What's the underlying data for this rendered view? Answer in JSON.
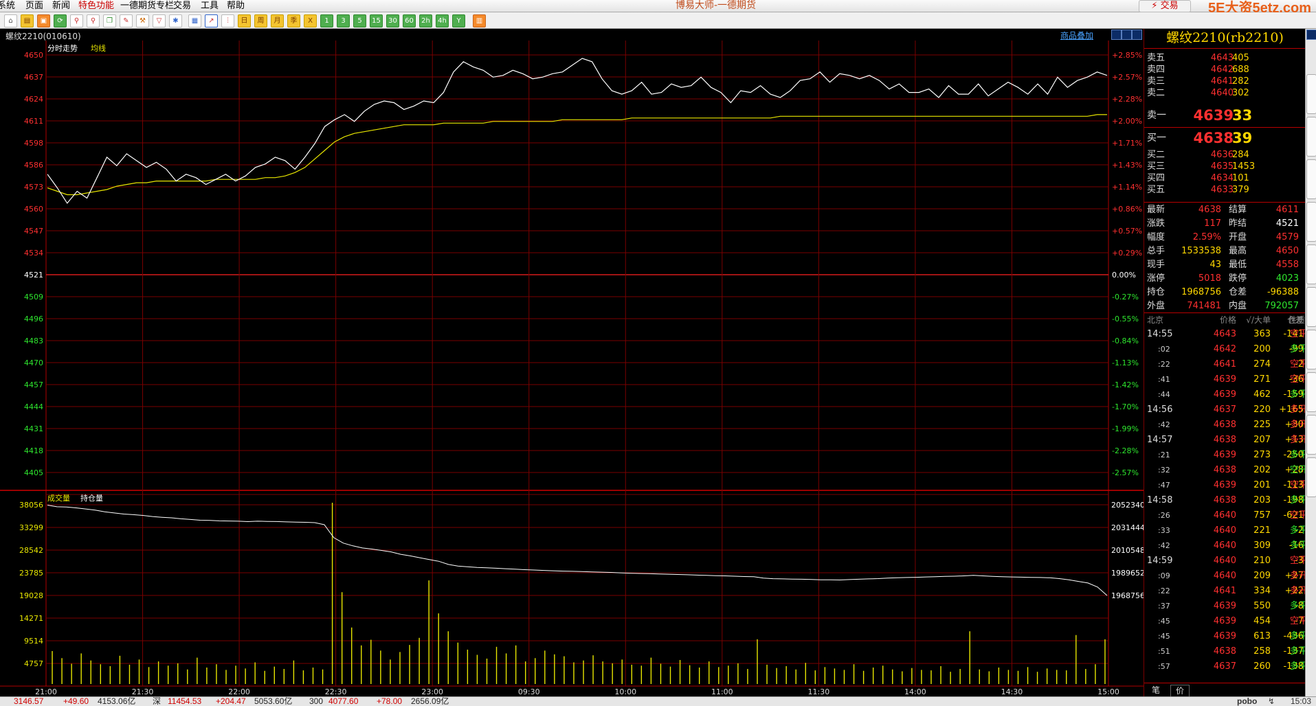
{
  "app_title": "博易大师-一德期货",
  "watermark": "5E大资5etz.com",
  "trade_button": "交易",
  "menus": [
    "系统",
    "页面",
    "新闻",
    "特色功能",
    "一德期货专栏",
    "交易",
    "工具",
    "帮助"
  ],
  "toolbar": {
    "icons": [
      "home-icon",
      "folder-icon",
      "news-icon",
      "refresh-icon",
      "zoom-in-icon",
      "zoom-out-icon",
      "window-icon",
      "pen-icon",
      "tool-icon",
      "filter-icon",
      "settings-icon",
      "table-icon",
      "intraday-icon",
      "kline-icon"
    ],
    "periods": [
      "日",
      "周",
      "月",
      "季",
      "X",
      "1",
      "3",
      "5",
      "15",
      "30",
      "60",
      "2h",
      "4h",
      "Y"
    ]
  },
  "symbol_label": "螺纹2210(010610)",
  "overlay_link": "商品叠加",
  "chart_data": [
    {
      "type": "line",
      "title": "分时走势",
      "series": [
        {
          "name": "分时走势",
          "color": "#ffffff",
          "values": [
            4580,
            4572,
            4563,
            4570,
            4566,
            4578,
            4590,
            4585,
            4592,
            4588,
            4584,
            4587,
            4583,
            4576,
            4580,
            4578,
            4574,
            4577,
            4580,
            4576,
            4579,
            4584,
            4586,
            4590,
            4588,
            4583,
            4590,
            4598,
            4608,
            4612,
            4615,
            4611,
            4617,
            4621,
            4623,
            4622,
            4618,
            4620,
            4623,
            4622,
            4628,
            4640,
            4646,
            4643,
            4641,
            4637,
            4638,
            4641,
            4639,
            4636,
            4637,
            4639,
            4640,
            4644,
            4648,
            4646,
            4636,
            4629,
            4627,
            4629,
            4634,
            4627,
            4628,
            4633,
            4631,
            4632,
            4637,
            4631,
            4628,
            4622,
            4629,
            4628,
            4632,
            4627,
            4625,
            4629,
            4635,
            4636,
            4640,
            4634,
            4639,
            4638,
            4636,
            4638,
            4635,
            4630,
            4633,
            4628,
            4628,
            4630,
            4625,
            4632,
            4627,
            4627,
            4633,
            4626,
            4630,
            4634,
            4631,
            4627,
            4633,
            4627,
            4637,
            4631,
            4635,
            4637,
            4640,
            4638
          ]
        },
        {
          "name": "均线",
          "color": "#e8e600",
          "values": [
            4572,
            4570,
            4568,
            4568,
            4569,
            4570,
            4571,
            4573,
            4574,
            4575,
            4575,
            4576,
            4576,
            4576,
            4576,
            4576,
            4576,
            4577,
            4577,
            4577,
            4577,
            4577,
            4578,
            4578,
            4579,
            4581,
            4584,
            4589,
            4594,
            4599,
            4602,
            4604,
            4605,
            4606,
            4607,
            4608,
            4609,
            4609,
            4609,
            4609,
            4610,
            4610,
            4610,
            4610,
            4610,
            4611,
            4611,
            4611,
            4611,
            4611,
            4611,
            4611,
            4612,
            4612,
            4612,
            4612,
            4612,
            4612,
            4612,
            4613,
            4613,
            4613,
            4613,
            4613,
            4613,
            4613,
            4613,
            4613,
            4613,
            4613,
            4613,
            4613,
            4613,
            4613,
            4614,
            4614,
            4614,
            4614,
            4614,
            4614,
            4614,
            4614,
            4614,
            4614,
            4614,
            4614,
            4614,
            4614,
            4614,
            4614,
            4614,
            4614,
            4614,
            4614,
            4614,
            4614,
            4614,
            4614,
            4614,
            4614,
            4614,
            4614,
            4614,
            4614,
            4614,
            4614,
            4615,
            4615
          ]
        }
      ],
      "price_ticks": [
        "4650",
        "4637",
        "4624",
        "4611",
        "4598",
        "4586",
        "4573",
        "4560",
        "4547",
        "4534",
        "4521",
        "4509",
        "4496",
        "4483",
        "4470",
        "4457",
        "4444",
        "4431",
        "4418",
        "4405"
      ],
      "pct_ticks": [
        "+2.85%",
        "+2.57%",
        "+2.28%",
        "+2.00%",
        "+1.71%",
        "+1.43%",
        "+1.14%",
        "+0.86%",
        "+0.57%",
        "+0.29%",
        "0.00%",
        "-0.27%",
        "-0.55%",
        "-0.84%",
        "-1.13%",
        "-1.42%",
        "-1.70%",
        "-1.99%",
        "-2.28%",
        "-2.57%"
      ],
      "reference_price": 4521,
      "ylim": [
        4405,
        4650
      ]
    },
    {
      "type": "bar",
      "title": "成交量",
      "secondary_label": "持仓量",
      "volume_ticks": [
        "38056",
        "33299",
        "28542",
        "23785",
        "19028",
        "14271",
        "9514",
        "4757"
      ],
      "oi_ticks": [
        "2052340",
        "2031444",
        "2010548",
        "1989652",
        "1968756"
      ],
      "volume": [
        7000,
        5500,
        4300,
        6500,
        5000,
        4200,
        3800,
        6000,
        4100,
        5200,
        3600,
        4800,
        3900,
        4400,
        3100,
        5600,
        3500,
        4200,
        3000,
        3900,
        3300,
        4600,
        2800,
        3700,
        3200,
        5000,
        2900,
        3500,
        3100,
        38500,
        19500,
        12000,
        8200,
        9400,
        7100,
        5200,
        6800,
        8300,
        9800,
        22000,
        15000,
        11200,
        8800,
        7300,
        6200,
        5400,
        7900,
        6500,
        8200,
        4800,
        5500,
        7100,
        6300,
        5900,
        4600,
        5000,
        6100,
        4800,
        4400,
        5200,
        4100,
        3900,
        5600,
        4300,
        3700,
        5100,
        4000,
        3500,
        4800,
        3600,
        3900,
        4400,
        3200,
        9500,
        4100,
        3400,
        3800,
        3100,
        4500,
        2900,
        3600,
        3300,
        3000,
        4200,
        2800,
        3500,
        3900,
        3100,
        2700,
        3400,
        3000,
        2900,
        3800,
        2600,
        3200,
        11200,
        3100,
        2700,
        3500,
        3000,
        2800,
        3600,
        2600,
        3300,
        3000,
        2900,
        10400,
        3200,
        4200,
        9500
      ],
      "open_interest": [
        2052000,
        2050500,
        2050300,
        2049500,
        2048500,
        2047400,
        2045800,
        2044800,
        2043800,
        2043200,
        2042500,
        2041500,
        2040800,
        2040300,
        2039400,
        2038800,
        2038100,
        2037900,
        2037500,
        2037400,
        2037200,
        2036800,
        2037200,
        2037000,
        2036900,
        2036600,
        2036400,
        2036200,
        2035900,
        2034000,
        2022000,
        2017000,
        2014500,
        2012500,
        2011500,
        2010200,
        2008900,
        2006700,
        2005200,
        2003500,
        2001800,
        2000200,
        1997300,
        1995800,
        1995200,
        1994600,
        1994200,
        1993800,
        1993400,
        1993000,
        1992500,
        1992200,
        1991800,
        1991500,
        1991200,
        1991000,
        1990700,
        1990400,
        1990200,
        1990000,
        1989600,
        1989300,
        1989000,
        1988800,
        1988500,
        1988300,
        1988100,
        1987800,
        1987500,
        1987300,
        1987000,
        1986800,
        1986500,
        1986200,
        1986000,
        1984800,
        1984200,
        1984000,
        1983800,
        1983700,
        1983500,
        1983200,
        1983200,
        1983000,
        1983400,
        1983700,
        1984000,
        1984300,
        1984800,
        1985000,
        1985300,
        1985500,
        1985800,
        1986000,
        1986300,
        1986500,
        1986800,
        1987300,
        1986800,
        1986300,
        1986000,
        1985800,
        1985600,
        1985400,
        1985300,
        1985000,
        1984300,
        1983200,
        1981700,
        1980200,
        1976500,
        1968700
      ],
      "ylim": [
        0,
        38056
      ],
      "oi_range": [
        1968756,
        2052340
      ]
    }
  ],
  "x_ticks": [
    "21:00",
    "21:30",
    "22:00",
    "22:30",
    "23:00",
    "09:30",
    "10:00",
    "11:00",
    "11:30",
    "14:00",
    "14:30",
    "15:00"
  ],
  "quote": {
    "title": "螺纹2210(rb2210)",
    "asks": [
      {
        "label": "卖五",
        "price": "4643",
        "vol": "405"
      },
      {
        "label": "卖四",
        "price": "4642",
        "vol": "688"
      },
      {
        "label": "卖三",
        "price": "4641",
        "vol": "282"
      },
      {
        "label": "卖二",
        "price": "4640",
        "vol": "302"
      },
      {
        "label": "卖一",
        "price": "4639",
        "vol": "33"
      }
    ],
    "bids": [
      {
        "label": "买一",
        "price": "4638",
        "vol": "39"
      },
      {
        "label": "买二",
        "price": "4636",
        "vol": "284"
      },
      {
        "label": "买三",
        "price": "4635",
        "vol": "1453"
      },
      {
        "label": "买四",
        "price": "4634",
        "vol": "101"
      },
      {
        "label": "买五",
        "price": "4633",
        "vol": "379"
      }
    ],
    "stats": [
      {
        "l1": "最新",
        "v1": "4638",
        "c1": "#ff3030",
        "l2": "结算",
        "v2": "4611",
        "c2": "#ff3030"
      },
      {
        "l1": "涨跌",
        "v1": "117",
        "c1": "#ff3030",
        "l2": "昨结",
        "v2": "4521",
        "c2": "#ffffff"
      },
      {
        "l1": "幅度",
        "v1": "2.59%",
        "c1": "#ff3030",
        "l2": "开盘",
        "v2": "4579",
        "c2": "#ff3030"
      },
      {
        "l1": "总手",
        "v1": "1533538",
        "c1": "#ffd700",
        "l2": "最高",
        "v2": "4650",
        "c2": "#ff3030"
      },
      {
        "l1": "现手",
        "v1": "43",
        "c1": "#ffd700",
        "l2": "最低",
        "v2": "4558",
        "c2": "#ff3030"
      },
      {
        "l1": "涨停",
        "v1": "5018",
        "c1": "#ff3030",
        "l2": "跌停",
        "v2": "4023",
        "c2": "#2ee62e"
      },
      {
        "l1": "持仓",
        "v1": "1968756",
        "c1": "#ffd700",
        "l2": "仓差",
        "v2": "-96388",
        "c2": "#ffd700"
      },
      {
        "l1": "外盘",
        "v1": "741481",
        "c1": "#ff3030",
        "l2": "内盘",
        "v2": "792057",
        "c2": "#2ee62e"
      }
    ],
    "trades_header": {
      "time": "北京",
      "price": "价格",
      "vol": "√/大单",
      "oi": "仓差",
      "nature": "性质"
    },
    "trades": [
      {
        "time": "14:55",
        "price": "4643",
        "vol": "363",
        "oi": "-141",
        "oi_color": "#ffd700",
        "nature": "空平",
        "nat_color": "#ff3030"
      },
      {
        "time": ":02",
        "price": "4642",
        "vol": "200",
        "oi": "-99",
        "oi_color": "#ffd700",
        "nature": "多平",
        "nat_color": "#2ee62e"
      },
      {
        "time": ":22",
        "price": "4641",
        "vol": "274",
        "oi": "-2",
        "oi_color": "#ffd700",
        "nature": "空平",
        "nat_color": "#ff3030"
      },
      {
        "time": ":41",
        "price": "4639",
        "vol": "271",
        "oi": "-36",
        "oi_color": "#ffd700",
        "nature": "空平",
        "nat_color": "#ff3030"
      },
      {
        "time": ":44",
        "price": "4639",
        "vol": "462",
        "oi": "-159",
        "oi_color": "#ffd700",
        "nature": "多平",
        "nat_color": "#2ee62e"
      },
      {
        "time": "14:56",
        "price": "4637",
        "vol": "220",
        "oi": "+165",
        "oi_color": "#ffd700",
        "nature": "多开",
        "nat_color": "#ff3030"
      },
      {
        "time": ":42",
        "price": "4638",
        "vol": "225",
        "oi": "+30",
        "oi_color": "#ffd700",
        "nature": "多开",
        "nat_color": "#ff3030"
      },
      {
        "time": "14:57",
        "price": "4638",
        "vol": "207",
        "oi": "+13",
        "oi_color": "#ffd700",
        "nature": "多开",
        "nat_color": "#ff3030"
      },
      {
        "time": ":21",
        "price": "4639",
        "vol": "273",
        "oi": "-250",
        "oi_color": "#ffd700",
        "nature": "多平",
        "nat_color": "#2ee62e"
      },
      {
        "time": ":32",
        "price": "4638",
        "vol": "202",
        "oi": "+28",
        "oi_color": "#ffd700",
        "nature": "空开",
        "nat_color": "#2ee62e"
      },
      {
        "time": ":47",
        "price": "4639",
        "vol": "201",
        "oi": "-113",
        "oi_color": "#ffd700",
        "nature": "空平",
        "nat_color": "#ff3030"
      },
      {
        "time": "14:58",
        "price": "4638",
        "vol": "203",
        "oi": "-198",
        "oi_color": "#ffd700",
        "nature": "多平",
        "nat_color": "#2ee62e"
      },
      {
        "time": ":26",
        "price": "4640",
        "vol": "757",
        "oi": "-621",
        "oi_color": "#ffd700",
        "nature": "空平",
        "nat_color": "#ff3030"
      },
      {
        "time": ":33",
        "price": "4640",
        "vol": "221",
        "oi": "-2",
        "oi_color": "#ffd700",
        "nature": "多平",
        "nat_color": "#2ee62e"
      },
      {
        "time": ":42",
        "price": "4640",
        "vol": "309",
        "oi": "-16",
        "oi_color": "#ffd700",
        "nature": "多平",
        "nat_color": "#2ee62e"
      },
      {
        "time": "14:59",
        "price": "4640",
        "vol": "210",
        "oi": "-3",
        "oi_color": "#ffd700",
        "nature": "空平",
        "nat_color": "#ff3030"
      },
      {
        "time": ":09",
        "price": "4640",
        "vol": "209",
        "oi": "+27",
        "oi_color": "#ffd700",
        "nature": "多开",
        "nat_color": "#ff3030"
      },
      {
        "time": ":22",
        "price": "4641",
        "vol": "334",
        "oi": "+22",
        "oi_color": "#ffd700",
        "nature": "多开",
        "nat_color": "#ff3030"
      },
      {
        "time": ":37",
        "price": "4639",
        "vol": "550",
        "oi": "-8",
        "oi_color": "#ffd700",
        "nature": "多平",
        "nat_color": "#2ee62e"
      },
      {
        "time": ":45",
        "price": "4639",
        "vol": "454",
        "oi": "-7",
        "oi_color": "#ffd700",
        "nature": "空平",
        "nat_color": "#ff3030"
      },
      {
        "time": ":45",
        "price": "4639",
        "vol": "613",
        "oi": "-436",
        "oi_color": "#ffd700",
        "nature": "多平",
        "nat_color": "#2ee62e"
      },
      {
        "time": ":51",
        "price": "4638",
        "vol": "258",
        "oi": "-137",
        "oi_color": "#ffd700",
        "nature": "多平",
        "nat_color": "#2ee62e"
      },
      {
        "time": ":57",
        "price": "4637",
        "vol": "260",
        "oi": "-138",
        "oi_color": "#ffd700",
        "nature": "多平",
        "nat_color": "#2ee62e"
      }
    ],
    "ticker_tabs": [
      "笔",
      "价"
    ]
  },
  "statusbar": [
    {
      "text": "3146.57",
      "color": "#d00000"
    },
    {
      "text": "+49.60",
      "color": "#d00000"
    },
    {
      "text": "4153.06亿",
      "color": "#222222"
    },
    {
      "text": "深",
      "color": "#222222"
    },
    {
      "text": "11454.53",
      "color": "#d00000"
    },
    {
      "text": "+204.47",
      "color": "#d00000"
    },
    {
      "text": "5053.60亿",
      "color": "#222222"
    },
    {
      "text": "300",
      "color": "#222222"
    },
    {
      "text": "4077.60",
      "color": "#d00000"
    },
    {
      "text": "+78.00",
      "color": "#d00000"
    },
    {
      "text": "2656.09亿",
      "color": "#222222"
    }
  ],
  "status_right": {
    "brand": "pobo",
    "time": "15:03"
  }
}
